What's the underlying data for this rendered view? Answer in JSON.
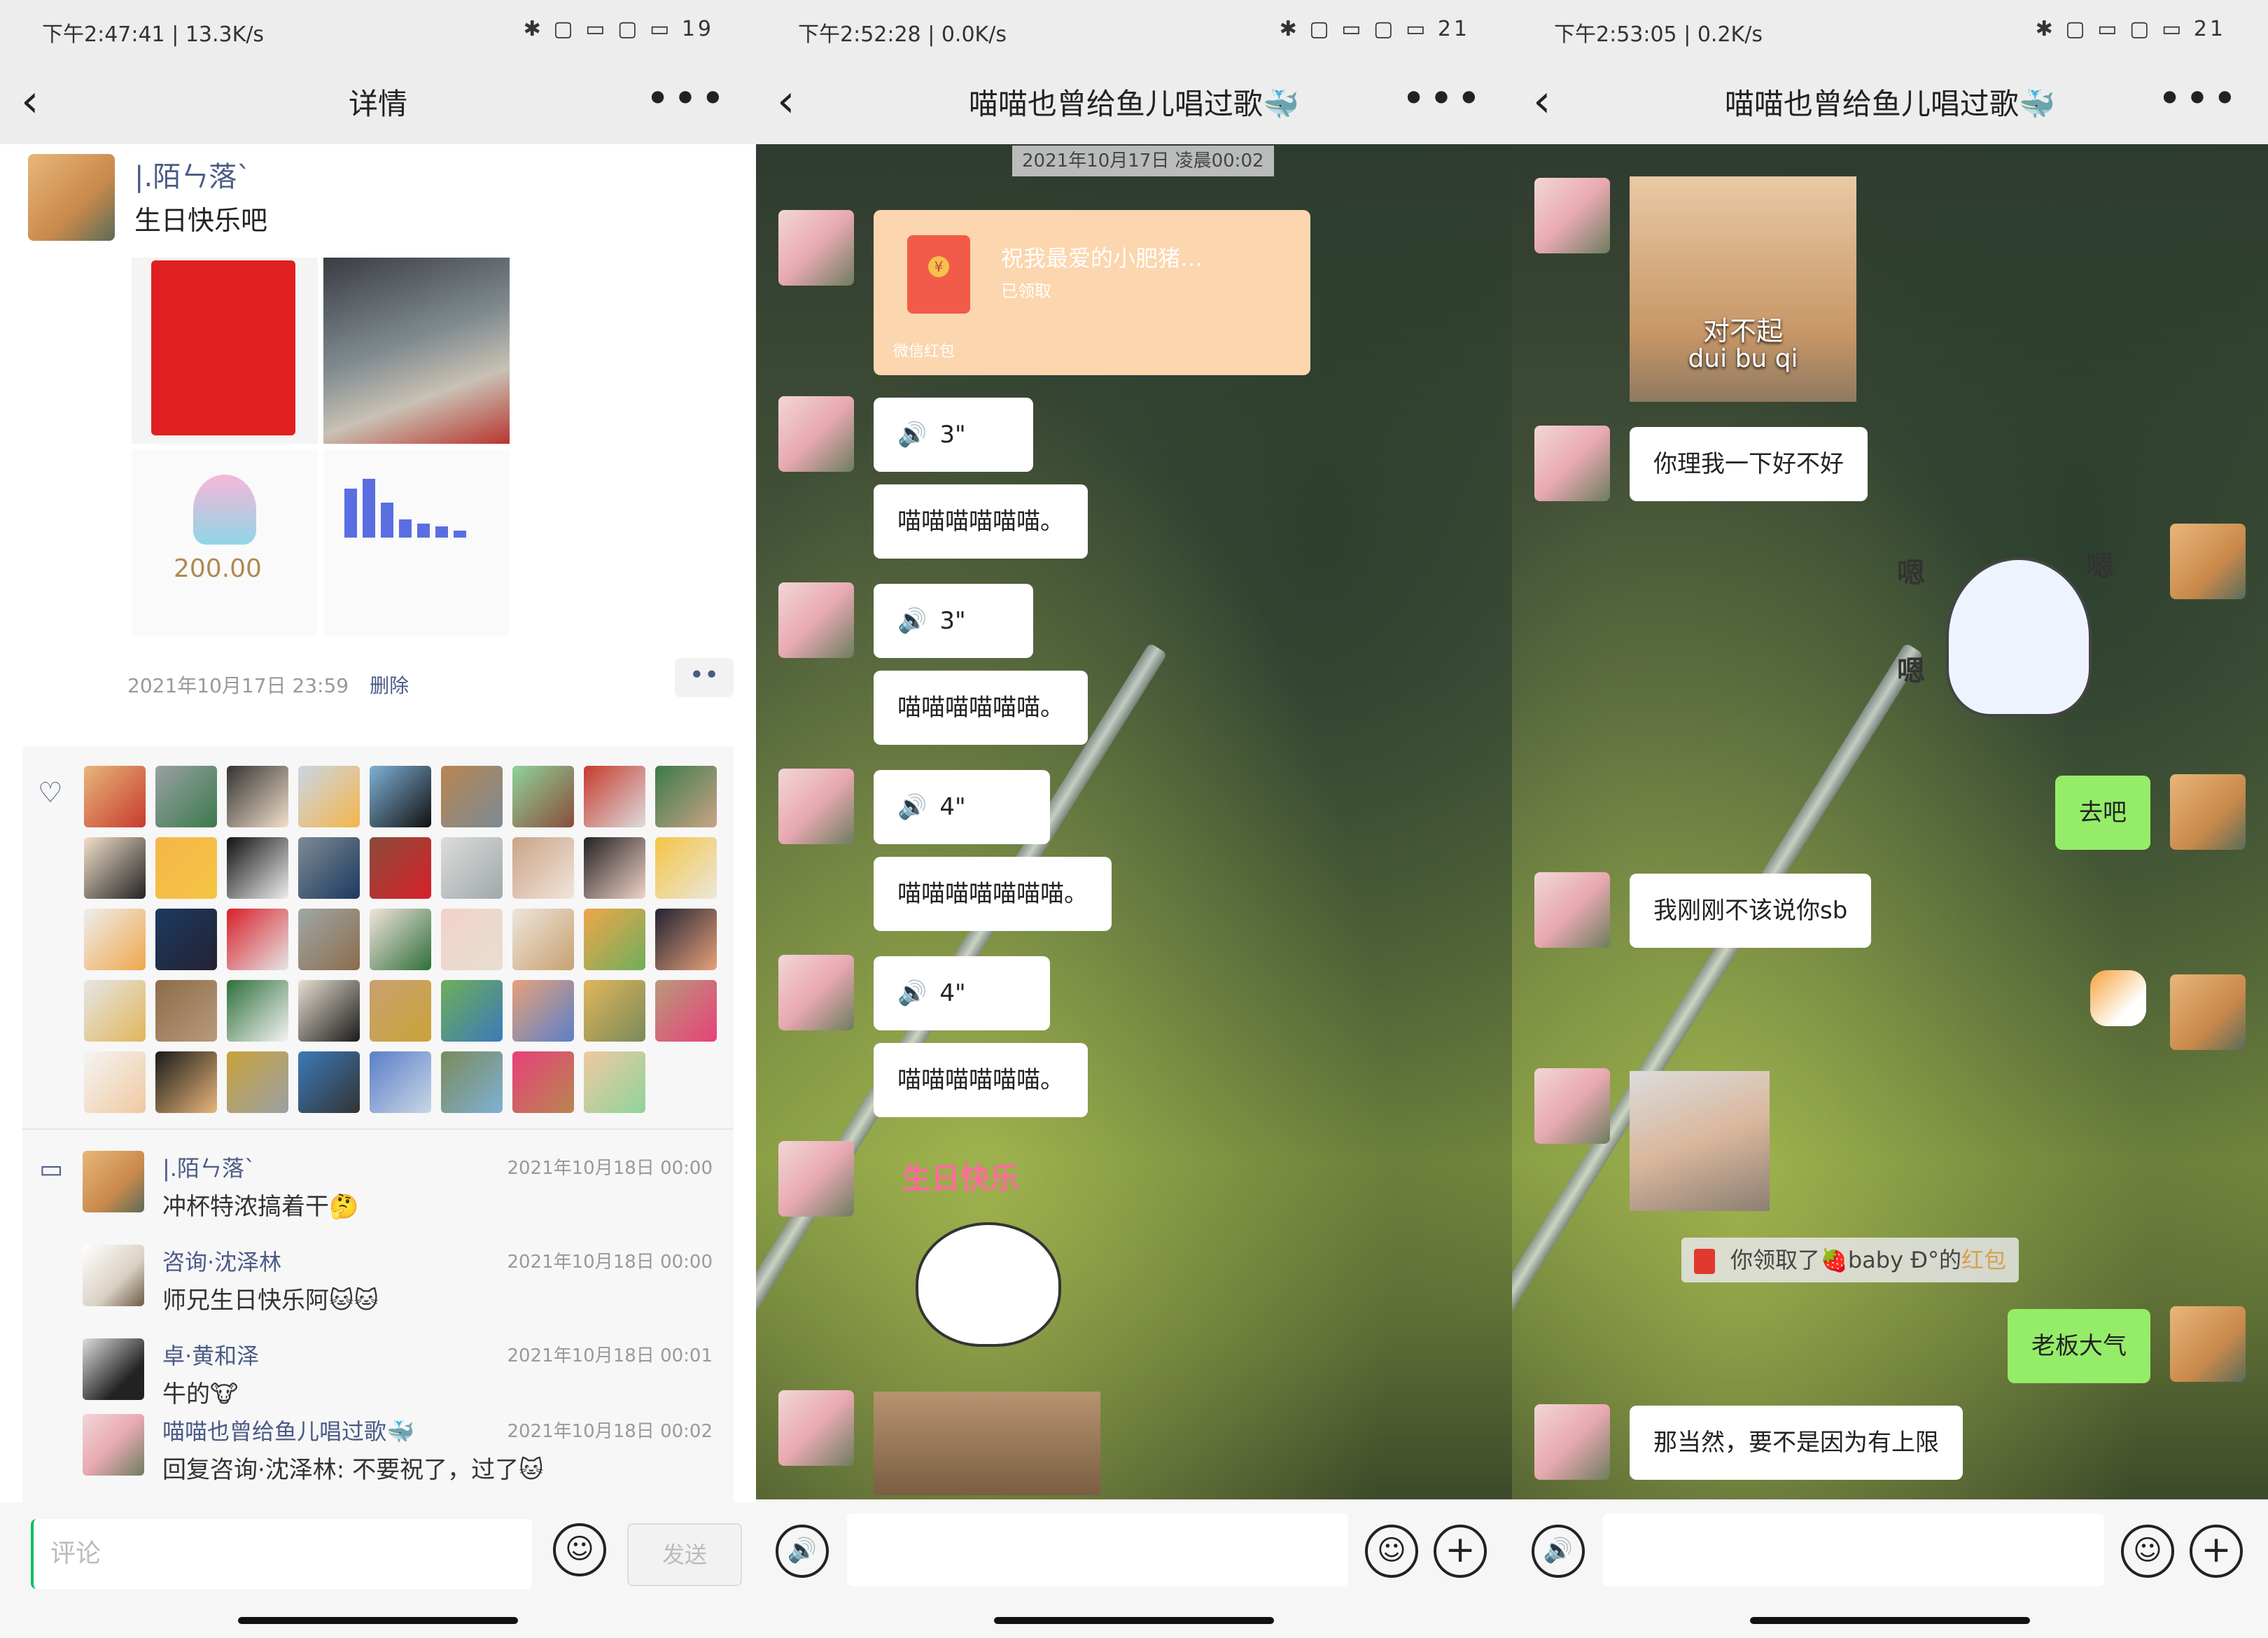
{
  "panel1": {
    "status": {
      "time": "下午2:47:41",
      "net": "13.3K/s",
      "right": "✱ ▢ ▭ ▢ ▭ 19"
    },
    "nav_title": "详情",
    "post": {
      "author": "|.陌ㄣ落`",
      "text": "生日快乐吧",
      "amount": "200.00",
      "time": "2021年10月17日 23:59",
      "delete": "删除"
    },
    "comments": [
      {
        "name": "|.陌ㄣ落`",
        "text": "冲杯特浓搞着干🤔",
        "date": "2021年10月18日 00:00"
      },
      {
        "name": "咨询·沈泽林",
        "text": "师兄生日快乐阿🐱🐱",
        "date": "2021年10月18日 00:00"
      },
      {
        "name": "卓·黄和泽",
        "text": "牛的🐮",
        "date": "2021年10月18日 00:01"
      },
      {
        "name": "喵喵也曾给鱼儿唱过歌🐳",
        "text": "回复咨询·沈泽林: 不要祝了，过了🐱",
        "date": "2021年10月18日 00:02"
      }
    ],
    "input_placeholder": "评论",
    "send_label": "发送"
  },
  "panel2": {
    "status": {
      "time": "下午2:52:28",
      "net": "0.0K/s",
      "right": "✱ ▢ ▭ ▢ ▭ 21"
    },
    "nav_title": "喵喵也曾给鱼儿唱过歌🐳",
    "date_chip": "2021年10月17日 凌晨00:02",
    "redpacket": {
      "title": "祝我最爱的小肥猪…",
      "status": "已领取",
      "footer": "微信红包"
    },
    "messages": [
      {
        "type": "voice",
        "duration": "3\""
      },
      {
        "type": "text",
        "text": "喵喵喵喵喵喵。"
      },
      {
        "type": "voice",
        "duration": "3\""
      },
      {
        "type": "text",
        "text": "喵喵喵喵喵喵。"
      },
      {
        "type": "voice",
        "duration": "4\""
      },
      {
        "type": "text",
        "text": "喵喵喵喵喵喵喵。"
      },
      {
        "type": "voice",
        "duration": "4\""
      },
      {
        "type": "text",
        "text": "喵喵喵喵喵喵。"
      }
    ],
    "bday_sticker": "生日快乐"
  },
  "panel3": {
    "status": {
      "time": "下午2:53:05",
      "net": "0.2K/s",
      "right": "✱ ▢ ▭ ▢ ▭ 21"
    },
    "nav_title": "喵喵也曾给鱼儿唱过歌🐳",
    "sorry_sticker": {
      "text": "对不起",
      "pinyin": "dui bu qi"
    },
    "ghost_text": "嗯",
    "messages": [
      {
        "side": "them",
        "text": "你理我一下好不好"
      },
      {
        "side": "me",
        "text": "去吧"
      },
      {
        "side": "them",
        "text": "我刚刚不该说你sb"
      },
      {
        "side": "me",
        "text": "老板大气"
      },
      {
        "side": "them",
        "text": "那当然，要不是因为有上限"
      }
    ],
    "sys_tip": {
      "prefix": "你领取了",
      "from": "🍓baby Đ°的",
      "link": "红包"
    }
  },
  "icons": {
    "back": "‹",
    "more": "•••",
    "voice": "🔊",
    "emoji": "☺",
    "plus": "+",
    "heart": "♡",
    "comment": "▭",
    "dots": "••"
  },
  "colors": {
    "link": "#4a5b86",
    "bubble_me": "#95ec69",
    "bubble_them": "#ffffff",
    "redpacket": "#fbd6ae"
  }
}
